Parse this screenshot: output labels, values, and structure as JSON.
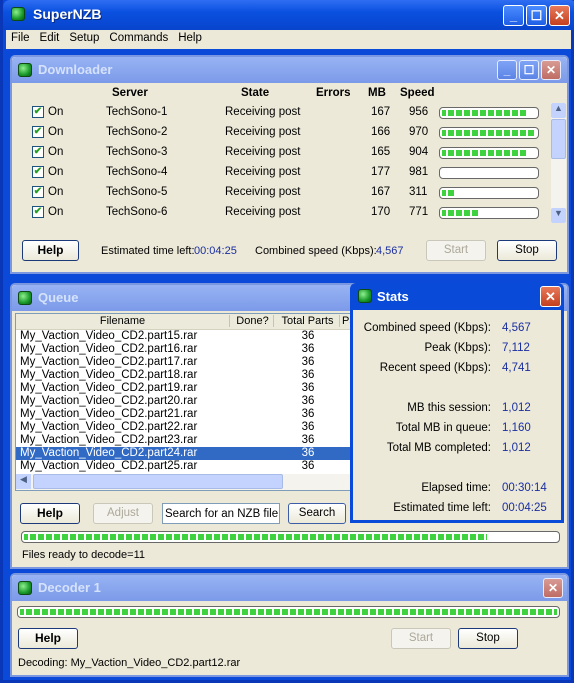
{
  "app": {
    "title": "SuperNZB"
  },
  "menu": [
    "File",
    "Edit",
    "Setup",
    "Commands",
    "Help"
  ],
  "downloader": {
    "title": "Downloader",
    "columns": [
      "Server",
      "State",
      "Errors",
      "MB",
      "Speed"
    ],
    "rows": [
      {
        "on": "On",
        "checked": true,
        "server": "TechSono-1",
        "state": "Receiving post",
        "errors": "",
        "mb": "167",
        "speed": "956",
        "progress": 0.92
      },
      {
        "on": "On",
        "checked": true,
        "server": "TechSono-2",
        "state": "Receiving post",
        "errors": "",
        "mb": "166",
        "speed": "970",
        "progress": 1.0
      },
      {
        "on": "On",
        "checked": true,
        "server": "TechSono-3",
        "state": "Receiving post",
        "errors": "",
        "mb": "165",
        "speed": "904",
        "progress": 0.92
      },
      {
        "on": "On",
        "checked": true,
        "server": "TechSono-4",
        "state": "Receiving post",
        "errors": "",
        "mb": "177",
        "speed": "981",
        "progress": 0.0
      },
      {
        "on": "On",
        "checked": true,
        "server": "TechSono-5",
        "state": "Receiving post",
        "errors": "",
        "mb": "167",
        "speed": "311",
        "progress": 0.17
      },
      {
        "on": "On",
        "checked": true,
        "server": "TechSono-6",
        "state": "Receiving post",
        "errors": "",
        "mb": "170",
        "speed": "771",
        "progress": 0.42
      }
    ],
    "help_label": "Help",
    "eta_label": "Estimated time left:",
    "eta_value": "00:04:25",
    "speed_label": "Combined speed (Kbps):",
    "speed_value": "4,567",
    "start_label": "Start",
    "stop_label": "Stop"
  },
  "queue": {
    "title": "Queue",
    "columns": [
      "Filename",
      "Done?",
      "Total Parts",
      "Pa"
    ],
    "rows": [
      {
        "filename": "My_Vaction_Video_CD2.part15.rar",
        "done": "",
        "total": "36"
      },
      {
        "filename": "My_Vaction_Video_CD2.part16.rar",
        "done": "",
        "total": "36"
      },
      {
        "filename": "My_Vaction_Video_CD2.part17.rar",
        "done": "",
        "total": "36"
      },
      {
        "filename": "My_Vaction_Video_CD2.part18.rar",
        "done": "",
        "total": "36"
      },
      {
        "filename": "My_Vaction_Video_CD2.part19.rar",
        "done": "",
        "total": "36"
      },
      {
        "filename": "My_Vaction_Video_CD2.part20.rar",
        "done": "",
        "total": "36"
      },
      {
        "filename": "My_Vaction_Video_CD2.part21.rar",
        "done": "",
        "total": "36"
      },
      {
        "filename": "My_Vaction_Video_CD2.part22.rar",
        "done": "",
        "total": "36"
      },
      {
        "filename": "My_Vaction_Video_CD2.part23.rar",
        "done": "",
        "total": "36"
      },
      {
        "filename": "My_Vaction_Video_CD2.part24.rar",
        "done": "",
        "total": "36",
        "selected": true
      },
      {
        "filename": "My_Vaction_Video_CD2.part25.rar",
        "done": "",
        "total": "36"
      }
    ],
    "help_label": "Help",
    "adjust_label": "Adjust",
    "search_value": "Search for an NZB file...",
    "search_label": "Search",
    "progress": 0.87,
    "status": "Files ready to decode=11"
  },
  "stats": {
    "title": "Stats",
    "rows": [
      {
        "label": "Combined speed (Kbps):",
        "value": "4,567"
      },
      {
        "label": "Peak (Kbps):",
        "value": "7,112"
      },
      {
        "label": "Recent speed (Kbps):",
        "value": "4,741"
      },
      {
        "label": "MB this session:",
        "value": "1,012"
      },
      {
        "label": "Total MB in queue:",
        "value": "1,160"
      },
      {
        "label": "Total MB completed:",
        "value": "1,012"
      },
      {
        "label": "Elapsed time:",
        "value": "00:30:14"
      },
      {
        "label": "Estimated time left:",
        "value": "00:04:25"
      }
    ]
  },
  "decoder": {
    "title": "Decoder 1",
    "progress": 1.0,
    "help_label": "Help",
    "start_label": "Start",
    "stop_label": "Stop",
    "status": "Decoding: My_Vaction_Video_CD2.part12.rar"
  },
  "colors": {
    "accent_value": "#1a2ea0",
    "progress_green": "#3ed23e",
    "selection": "#316ac5"
  }
}
